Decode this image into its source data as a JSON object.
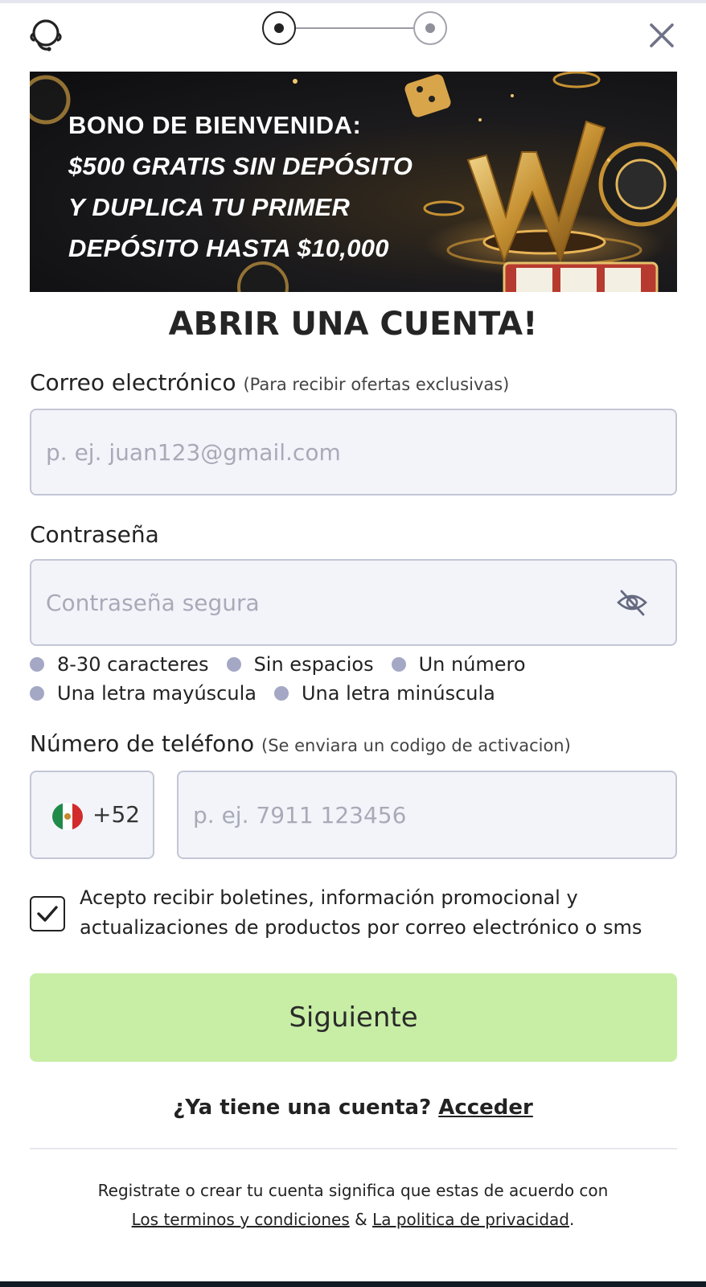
{
  "stepper": {
    "current_step": 1,
    "total_steps": 2
  },
  "banner": {
    "line1": "BONO DE BIENVENIDA:",
    "line2": "$500 GRATIS SIN DEPÓSITO",
    "line3": "Y DUPLICA TU PRIMER",
    "line4": "DEPÓSITO HASTA $10,000"
  },
  "title": "ABRIR UNA CUENTA!",
  "email": {
    "label": "Correo electrónico",
    "hint": "(Para recibir ofertas exclusivas)",
    "placeholder": "p. ej. juan123@gmail.com",
    "value": ""
  },
  "password": {
    "label": "Contraseña",
    "placeholder": "Contraseña segura",
    "value": "",
    "rules": [
      "8-30 caracteres",
      "Sin espacios",
      "Un número",
      "Una letra mayúscula",
      "Una letra minúscula"
    ]
  },
  "phone": {
    "label": "Número de teléfono",
    "hint": "(Se enviara un codigo de activacion)",
    "country_code": "+52",
    "country_flag": "mexico-flag",
    "placeholder": "p. ej. 7911 123456",
    "value": ""
  },
  "consent": {
    "checked": true,
    "text": "Acepto recibir boletines, información promocional y actualizaciones de productos por correo electrónico o sms"
  },
  "next_button": {
    "label": "Siguiente",
    "color": "#c8eea6"
  },
  "login": {
    "prompt": "¿Ya tiene una cuenta?",
    "link": "Acceder"
  },
  "legal": {
    "text": "Registrate o crear tu cuenta significa que estas de acuerdo con",
    "terms_link": "Los terminos y condiciones",
    "separator": "&",
    "privacy_link": "La politica de privacidad",
    "end": "."
  },
  "icons": {
    "support": "headset-chat-icon",
    "close": "close-icon",
    "eye": "eye-slash-icon",
    "check": "check-icon"
  }
}
